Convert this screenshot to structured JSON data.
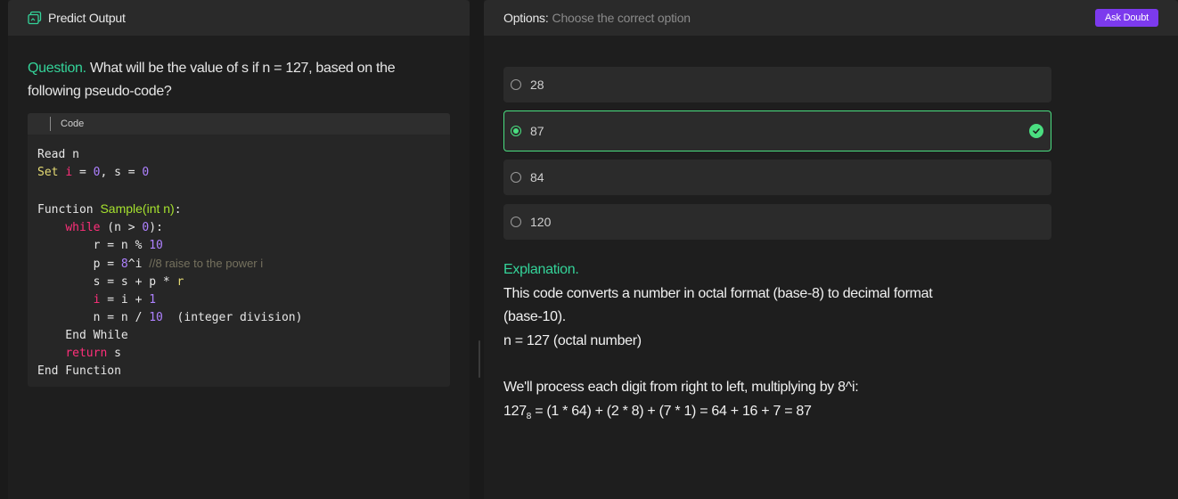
{
  "left_panel": {
    "title": "Predict Output",
    "icon": "code-window-icon"
  },
  "question": {
    "label": "Question.",
    "text": "What will be the value of s if n = 127, based on the following pseudo-code?"
  },
  "code": {
    "tab_label": "Code",
    "lines": [
      "Read n",
      "Set i = 0, s = 0",
      "",
      "Function Sample(int n):",
      "while (n > 0):",
      "r = n % 10",
      "p = 8^i //8 raise to the power i",
      "s = s + p * r",
      "i = i + 1",
      "n = n / 10  (integer division)",
      "End While",
      "return s",
      "End Function"
    ]
  },
  "right_panel": {
    "options_label": "Options:",
    "options_hint": "Choose the correct option",
    "ask_button": "Ask Doubt",
    "accent_color": "#7c3aed"
  },
  "options": [
    {
      "label": "28",
      "selected": false
    },
    {
      "label": "87",
      "selected": true
    },
    {
      "label": "84",
      "selected": false
    },
    {
      "label": "120",
      "selected": false
    }
  ],
  "explanation": {
    "label": "Explanation.",
    "line1": "This code converts a number in octal format (base-8) to decimal format (base-10).",
    "line2": "n = 127 (octal number)",
    "line3": "We'll process each digit from right to left, multiplying by 8^i:",
    "line4_base": "127",
    "line4_sub": "8",
    "line4_rest": " = (1 * 64) + (2 * 8) + (7 * 1) = 64 + 16 + 7 = 87"
  },
  "colors": {
    "correct": "#4ade80",
    "label_green": "#34d399"
  }
}
